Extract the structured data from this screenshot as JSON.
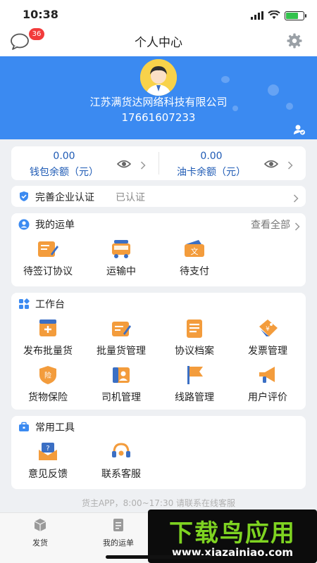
{
  "status_bar": {
    "time": "10:38"
  },
  "header": {
    "title": "个人中心",
    "message_badge": "36"
  },
  "profile": {
    "company": "江苏满货达网络科技有限公司",
    "phone": "17661607233"
  },
  "balances": [
    {
      "value": "0.00",
      "label": "钱包余额（元）"
    },
    {
      "value": "0.00",
      "label": "油卡余额（元）"
    }
  ],
  "certification": {
    "label": "完善企业认证",
    "status": "已认证"
  },
  "my_orders": {
    "title": "我的运单",
    "view_all": "查看全部",
    "items": [
      {
        "label": "待签订协议",
        "icon": "contract-icon"
      },
      {
        "label": "运输中",
        "icon": "truck-icon"
      },
      {
        "label": "待支付",
        "icon": "payment-icon"
      }
    ]
  },
  "workbench": {
    "title": "工作台",
    "items": [
      {
        "label": "发布批量货",
        "icon": "publish-cargo-icon"
      },
      {
        "label": "批量货管理",
        "icon": "cargo-manage-icon"
      },
      {
        "label": "协议档案",
        "icon": "agreement-archive-icon"
      },
      {
        "label": "发票管理",
        "icon": "invoice-icon"
      },
      {
        "label": "货物保险",
        "icon": "insurance-icon"
      },
      {
        "label": "司机管理",
        "icon": "driver-icon"
      },
      {
        "label": "线路管理",
        "icon": "route-flag-icon"
      },
      {
        "label": "用户评价",
        "icon": "review-megaphone-icon"
      }
    ]
  },
  "tools": {
    "title": "常用工具",
    "items": [
      {
        "label": "意见反馈",
        "icon": "feedback-icon"
      },
      {
        "label": "联系客服",
        "icon": "headset-icon"
      }
    ]
  },
  "footer_tip": "货主APP，8:00~17:30 请联系在线客服",
  "tabbar": {
    "items": [
      {
        "label": "发货",
        "icon": "cube-icon"
      },
      {
        "label": "我的运单",
        "icon": "document-icon"
      }
    ]
  },
  "watermark": {
    "main": "下载鸟应用",
    "url": "www.xiazainiao.com"
  },
  "colors": {
    "accent_blue": "#3b8af1",
    "icon_orange": "#f39c3c",
    "badge_red": "#f23b3b",
    "text_blue": "#1f5bb5"
  }
}
